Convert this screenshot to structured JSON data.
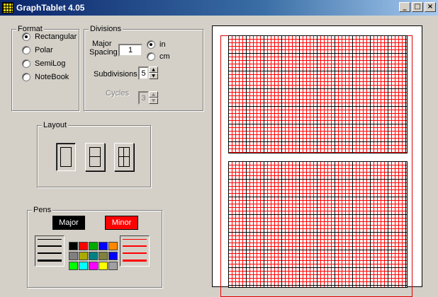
{
  "window": {
    "title": "GraphTablet 4.05",
    "buttons": {
      "minimize": "_",
      "maximize": "□",
      "close": "×"
    }
  },
  "format": {
    "label": "Format",
    "options": [
      "Rectangular",
      "Polar",
      "SemiLog",
      "NoteBook"
    ],
    "selected": "Rectangular"
  },
  "divisions": {
    "label": "Divisions",
    "major_spacing_label_1": "Major",
    "major_spacing_label_2": "Spacing",
    "major_spacing_value": "1",
    "units": [
      "in",
      "cm"
    ],
    "selected_unit": "in",
    "subdivisions_label": "Subdivisions",
    "subdivisions_value": "5",
    "cycles_label": "Cycles",
    "cycles_value": "3"
  },
  "layout": {
    "label": "Layout",
    "options": [
      "single",
      "two-stacked",
      "four-grid"
    ]
  },
  "pens": {
    "label": "Pens",
    "major_label": "Major",
    "minor_label": "Minor",
    "major_color": "#000000",
    "minor_color": "#ff0000",
    "palette": [
      "#000000",
      "#ff0000",
      "#00aa00",
      "#0000ff",
      "#ff8800",
      "#808080",
      "#aaaa00",
      "#008080",
      "#808040",
      "#0000ff",
      "#00ff00",
      "#00ffff",
      "#ff00ff",
      "#ffff00",
      "#a0a0a0"
    ]
  },
  "preview": {
    "major_color": "#000000",
    "minor_color": "#ff0000",
    "page_outline_color": "#e00000"
  }
}
